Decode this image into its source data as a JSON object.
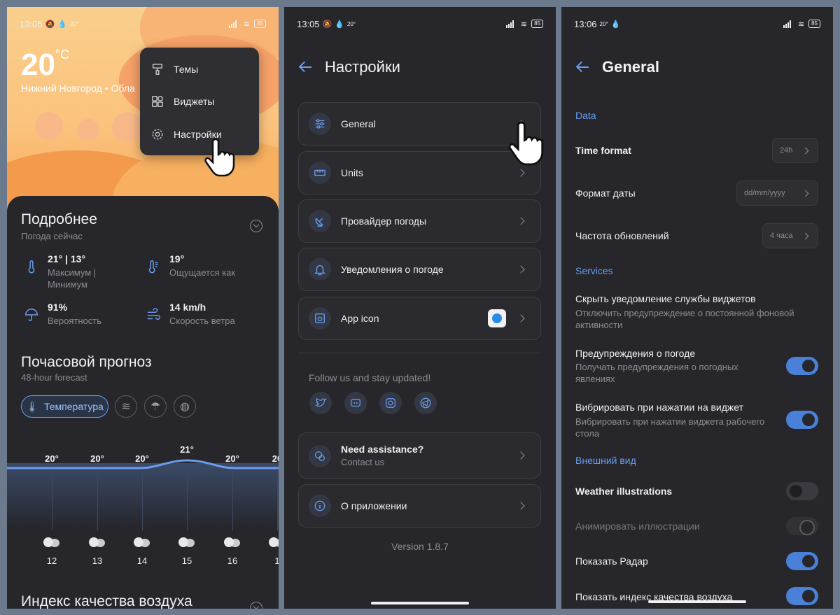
{
  "phone1": {
    "status": {
      "time": "13:05",
      "temp": "20°",
      "battery": "85"
    },
    "weather": {
      "temp": "20",
      "unit": "°C",
      "city": "Нижний Новгород • Обла"
    },
    "menu": [
      {
        "label": "Темы",
        "icon": "brush-icon"
      },
      {
        "label": "Виджеты",
        "icon": "widgets-icon"
      },
      {
        "label": "Настройки",
        "icon": "gear-icon"
      }
    ],
    "details": {
      "title": "Подробнее",
      "subtitle": "Погода сейчас",
      "items": [
        {
          "value": "21° | 13°",
          "label": "Максимум | Минимум",
          "icon": "thermometer-icon"
        },
        {
          "value": "19°",
          "label": "Ощущается как",
          "icon": "thermometer-feels-icon"
        },
        {
          "value": "91%",
          "label": "Вероятность",
          "icon": "umbrella-icon"
        },
        {
          "value": "14 km/h",
          "label": "Скорость ветра",
          "icon": "wind-icon"
        }
      ]
    },
    "hourly": {
      "title": "Почасовой прогноз",
      "subtitle": "48-hour forecast",
      "active_tab": "Температура",
      "temps": [
        "20°",
        "20°",
        "20°",
        "21°",
        "20°",
        "20"
      ],
      "hours": [
        "12",
        "13",
        "14",
        "15",
        "16",
        "1"
      ]
    },
    "aqi_title": "Индекс качества воздуха"
  },
  "phone2": {
    "status": {
      "time": "13:05",
      "temp": "20°",
      "battery": "85"
    },
    "title": "Настройки",
    "items": [
      {
        "label": "General",
        "icon": "sliders-icon"
      },
      {
        "label": "Units",
        "icon": "ruler-icon"
      },
      {
        "label": "Провайдер погоды",
        "icon": "satellite-dish-icon"
      },
      {
        "label": "Уведомления о погоде",
        "icon": "bell-icon"
      },
      {
        "label": "App icon",
        "icon": "app-icon"
      }
    ],
    "follow": "Follow us and stay updated!",
    "social": [
      "twitter-icon",
      "discord-icon",
      "instagram-icon",
      "telegram-icon"
    ],
    "assist": {
      "title": "Need assistance?",
      "sub": "Contact us"
    },
    "about": "О приложении",
    "version": "Version 1.8.7"
  },
  "phone3": {
    "status": {
      "time": "13:06",
      "temp": "20°",
      "battery": "85"
    },
    "title": "General",
    "sections": {
      "data": "Data",
      "services": "Services",
      "appearance": "Внешний вид"
    },
    "time_format": {
      "label": "Time format",
      "value": "24h"
    },
    "date_format": {
      "label": "Формат даты",
      "value": "dd/mm/yyyy"
    },
    "update_freq": {
      "label": "Частота обновлений",
      "value": "4 часа"
    },
    "hide_notif": {
      "label": "Скрыть уведомление службы виджетов",
      "sub": "Отключить предупреждение о постоянной фоновой активности"
    },
    "warnings": {
      "label": "Предупреждения о погоде",
      "sub": "Получать предупреждения о погодных явлениях",
      "on": true
    },
    "vibrate": {
      "label": "Вибрировать при нажатии на виджет",
      "sub": "Вибрировать при нажатии виджета рабочего стола",
      "on": true
    },
    "illustrations": {
      "label": "Weather illustrations",
      "on": false
    },
    "animate": {
      "label": "Анимировать иллюстрации",
      "on": true,
      "disabled": true
    },
    "radar": {
      "label": "Показать Радар",
      "on": true
    },
    "aqi": {
      "label": "Показать индекс качества воздуха",
      "on": true
    }
  },
  "colors": {
    "accent": "#6a9df0",
    "background": "#26262b",
    "card": "#2a2a2f",
    "hero": "#fbc27c"
  }
}
